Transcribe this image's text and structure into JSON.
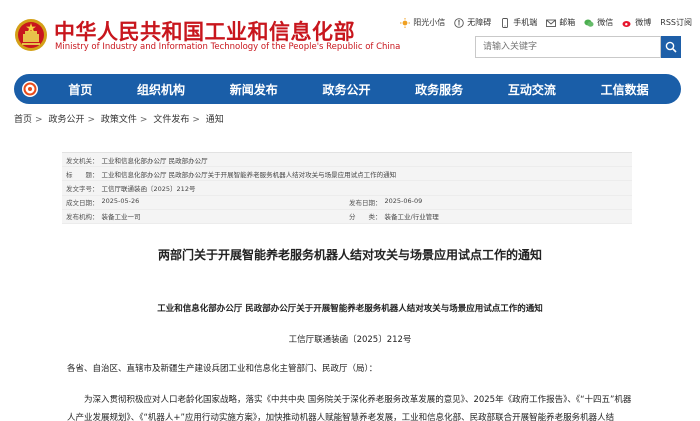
{
  "header": {
    "title": "中华人民共和国工业和信息化部",
    "subtitle": "Ministry of Industry and Information Technology of the People's Republic of China",
    "toplinks": [
      {
        "label": "阳光小信",
        "icon": "sun-icon"
      },
      {
        "label": "无障碍",
        "icon": "accessibility-icon"
      },
      {
        "label": "手机端",
        "icon": "phone-icon"
      },
      {
        "label": "邮箱",
        "icon": "mail-icon"
      },
      {
        "label": "微信",
        "icon": "wechat-icon"
      },
      {
        "label": "微博",
        "icon": "weibo-icon"
      },
      {
        "label": "RSS订阅",
        "icon": "rss-icon"
      }
    ],
    "search_placeholder": "请输入关键字"
  },
  "nav": {
    "items": [
      "首页",
      "组织机构",
      "新闻发布",
      "政务公开",
      "政务服务",
      "互动交流",
      "工信数据"
    ]
  },
  "breadcrumb": [
    "首页",
    "政务公开",
    "政策文件",
    "文件发布",
    "通知"
  ],
  "meta": {
    "issuer_key": "发文机关：",
    "issuer": "工业和信息化部办公厅 民政部办公厅",
    "title_key": "标　　题：",
    "title": "工业和信息化部办公厅 民政部办公厅关于开展智能养老服务机器人结对攻关与场景应用试点工作的通知",
    "docno_key": "发文字号：",
    "docno": "工信厅联通装函〔2025〕212号",
    "created_key": "成文日期：",
    "created": "2025-05-26",
    "published_key": "发布日期：",
    "published": "2025-06-09",
    "org_key": "发布机构：",
    "org": "装备工业一司",
    "category_key": "分　　类：",
    "category": "装备工业/行业管理"
  },
  "doc": {
    "title": "两部门关于开展智能养老服务机器人结对攻关与场景应用试点工作的通知",
    "subtitle": "工业和信息化部办公厅 民政部办公厅关于开展智能养老服务机器人结对攻关与场景应用试点工作的通知",
    "number": "工信厅联通装函〔2025〕212号",
    "recipients": "各省、自治区、直辖市及新疆生产建设兵团工业和信息化主管部门、民政厅（局）：",
    "body": "为深入贯彻积极应对人口老龄化国家战略，落实《中共中央 国务院关于深化养老服务改革发展的意见》、2025年《政府工作报告》、《“十四五”机器人产业发展规划》、《“机器人+”应用行动实施方案》，加快推动机器人赋能智慧养老发展，工业和信息化部、民政部联合开展智能养老服务机器人结"
  },
  "colors": {
    "brand_red": "#c8161d",
    "nav_blue": "#1a5ea8"
  }
}
